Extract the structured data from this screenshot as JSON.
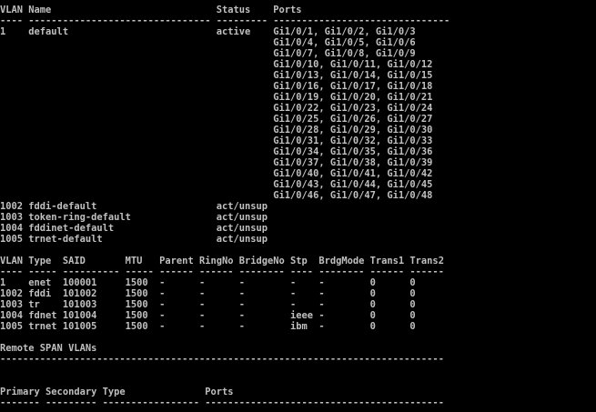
{
  "terminal": {
    "lines": [
      "VLAN Name                             Status    Ports",
      "---- -------------------------------- --------- -------------------------------",
      "1    default                          active    Gi1/0/1, Gi1/0/2, Gi1/0/3",
      "                                                Gi1/0/4, Gi1/0/5, Gi1/0/6",
      "                                                Gi1/0/7, Gi1/0/8, Gi1/0/9",
      "                                                Gi1/0/10, Gi1/0/11, Gi1/0/12",
      "                                                Gi1/0/13, Gi1/0/14, Gi1/0/15",
      "                                                Gi1/0/16, Gi1/0/17, Gi1/0/18",
      "                                                Gi1/0/19, Gi1/0/20, Gi1/0/21",
      "                                                Gi1/0/22, Gi1/0/23, Gi1/0/24",
      "                                                Gi1/0/25, Gi1/0/26, Gi1/0/27",
      "                                                Gi1/0/28, Gi1/0/29, Gi1/0/30",
      "                                                Gi1/0/31, Gi1/0/32, Gi1/0/33",
      "                                                Gi1/0/34, Gi1/0/35, Gi1/0/36",
      "                                                Gi1/0/37, Gi1/0/38, Gi1/0/39",
      "                                                Gi1/0/40, Gi1/0/41, Gi1/0/42",
      "                                                Gi1/0/43, Gi1/0/44, Gi1/0/45",
      "                                                Gi1/0/46, Gi1/0/47, Gi1/0/48",
      "1002 fddi-default                     act/unsup",
      "1003 token-ring-default               act/unsup",
      "1004 fddinet-default                  act/unsup",
      "1005 trnet-default                    act/unsup",
      "",
      "VLAN Type  SAID       MTU   Parent RingNo BridgeNo Stp  BrdgMode Trans1 Trans2",
      "---- ----- ---------- ----- ------ ------ -------- ---- -------- ------ ------",
      "1    enet  100001     1500  -      -      -        -    -        0      0",
      "1002 fddi  101002     1500  -      -      -        -    -        0      0",
      "1003 tr    101003     1500  -      -      -        -    -        0      0",
      "1004 fdnet 101004     1500  -      -      -        ieee -        0      0",
      "1005 trnet 101005     1500  -      -      -        ibm  -        0      0",
      "",
      "Remote SPAN VLANs",
      "------------------------------------------------------------------------------",
      "",
      "",
      "Primary Secondary Type              Ports",
      "------- --------- ----------------- ------------------------------------------"
    ]
  }
}
